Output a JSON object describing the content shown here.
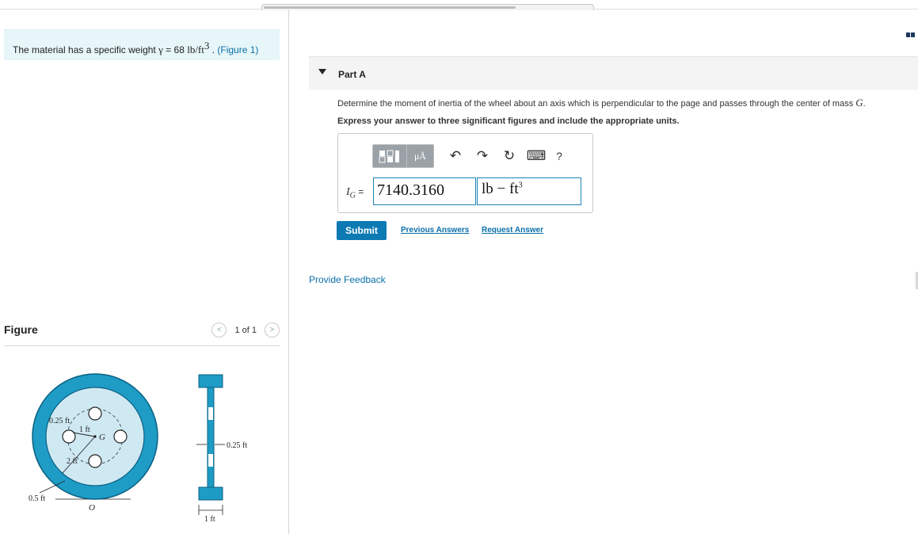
{
  "problem": {
    "text_before": "The material has a specific weight ",
    "gamma_symbol": "γ",
    "equals": " = 68 ",
    "unit_base": "lb/ft",
    "unit_exp": "3",
    "separator": " . ",
    "figure_link": "(Figure 1)"
  },
  "figure": {
    "title": "Figure",
    "pager_text": "1 of 1",
    "prev_glyph": "<",
    "next_glyph": ">",
    "labels": {
      "hole_radius": "0.25 ft",
      "hole_distance": "1 ft",
      "center": "G",
      "outer_radius": "2 ft",
      "rim_width": "0.5 ft",
      "pivot": "O",
      "section_thickness": "0.25 ft",
      "section_width": "1 ft"
    }
  },
  "part": {
    "title": "Part A",
    "question_before": "Determine the moment of inertia of the wheel about an axis which is perpendicular to the page and passes through the center of mass ",
    "question_var": "G",
    "question_after": ".",
    "instruction": "Express your answer to three significant figures and include the appropriate units."
  },
  "answer": {
    "label_symbol": "I",
    "label_sub": "G",
    "label_eq": " = ",
    "value": "7140.3160",
    "units_base": "lb − ft",
    "units_exp": "3",
    "toolbar": {
      "units_label": "μÅ",
      "undo": "↶",
      "redo": "↷",
      "reset": "↻",
      "keyboard": "⌨",
      "help": "?"
    }
  },
  "actions": {
    "submit": "Submit",
    "previous_answers": "Previous Answers",
    "request_answer": "Request Answer",
    "provide_feedback": "Provide Feedback"
  },
  "colors": {
    "accent": "#0d7ab4",
    "link": "#0a6fa8",
    "problem_bg": "#e7f6f8",
    "wheel_fill": "#1e9cc6"
  }
}
